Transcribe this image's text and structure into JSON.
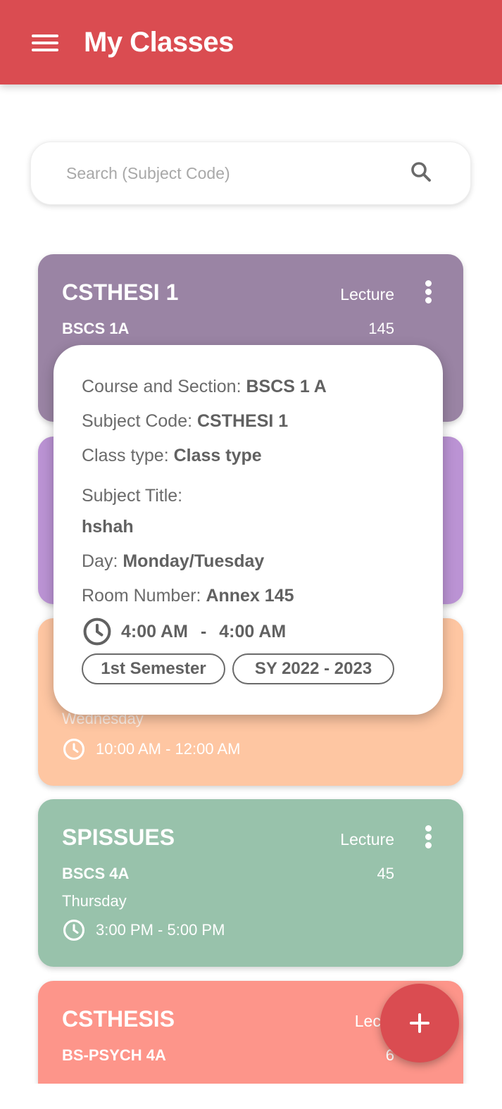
{
  "appbar": {
    "title": "My Classes",
    "color": "#da4c51",
    "menu_icon": "menu-icon"
  },
  "search": {
    "placeholder": "Search (Subject Code)",
    "value": "",
    "icon": "search-icon"
  },
  "cards": [
    {
      "code": "CSTHESI 1",
      "type": "Lecture",
      "section": "BSCS 1A",
      "room": "145",
      "day": "",
      "time": "",
      "color": "#9a84a4"
    },
    {
      "code": "",
      "type": "",
      "section": "",
      "room": "",
      "day": "",
      "time": "",
      "color": "#bb93d4"
    },
    {
      "code": "",
      "type": "",
      "section": "",
      "room": "",
      "day": "Wednesday",
      "time": "10:00 AM - 12:00 AM",
      "color": "#fec6a2"
    },
    {
      "code": "SPISSUES",
      "type": "Lecture",
      "section": "BSCS 4A",
      "room": "45",
      "day": "Thursday",
      "time": "3:00 PM - 5:00 PM",
      "color": "#98c2ab"
    },
    {
      "code": "CSTHESIS",
      "type": "Lectu",
      "section": "BS-PSYCH 4A",
      "room": "6",
      "day": "",
      "time": "",
      "color": "#fd958a"
    }
  ],
  "popup": {
    "course_label": "Course and Section:",
    "course_value": "BSCS 1 A",
    "code_label": "Subject Code:",
    "code_value": "CSTHESI 1",
    "type_label": "Class type:",
    "type_value": "Class type",
    "title_label": "Subject Title:",
    "title_value": "hshah",
    "day_label": "Day:",
    "day_value": "Monday/Tuesday",
    "room_label": "Room Number:",
    "room_value": "Annex 145",
    "time_start": "4:00 AM",
    "time_sep": "-",
    "time_end": "4:00 AM",
    "semester": "1st Semester",
    "school_year": "SY 2022 - 2023"
  },
  "fab": {
    "icon": "plus-icon",
    "color": "#da4c51"
  }
}
